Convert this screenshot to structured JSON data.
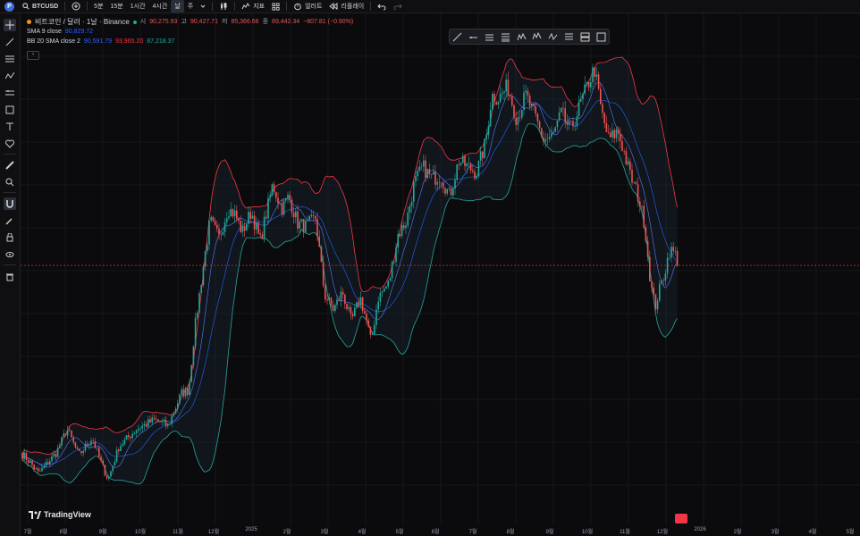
{
  "topbar": {
    "symbol": "BTCUSD",
    "avatar_letter": "P",
    "timeframes": [
      "5분",
      "15분",
      "1시간",
      "4시간",
      "날",
      "주"
    ],
    "active_timeframe_index": 4,
    "indicators": "지표",
    "alert": "얼러트",
    "replay": "리플레이"
  },
  "legend": {
    "title": "비트코인 / 달러 · 1날 · Binance",
    "open_label": "시",
    "open_value": "90,275.93",
    "high_label": "고",
    "high_value": "90,427.71",
    "low_label": "저",
    "low_value": "85,366.66",
    "close_label": "종",
    "close_value": "89,442.34",
    "change_value": "−807.81 (−0.90%)",
    "sma_label": "SMA 9 close",
    "sma_value": "90,829.72",
    "bb_label": "BB 20 SMA close 2",
    "bb_basis": "90,591.79",
    "bb_upper": "93,965.20",
    "bb_lower": "87,218.37"
  },
  "x_axis": {
    "ticks": [
      "7월",
      "8월",
      "9월",
      "10월",
      "11월",
      "12월",
      "2025",
      "2월",
      "3월",
      "4월",
      "5월",
      "6월",
      "7월",
      "8월",
      "9월",
      "10월",
      "11월",
      "12월",
      "2026",
      "2월",
      "3월",
      "4월",
      "5월"
    ]
  },
  "brand": {
    "logo_text": "TradingView"
  },
  "colors": {
    "up": "#26a69a",
    "down": "#ef5350",
    "sma": "#2962ff",
    "bb_upper": "#f23645",
    "bb_lower": "#26a69a",
    "bb_basis": "#2962ff",
    "price_line": "#f23645"
  },
  "chart_data": {
    "type": "candlestick",
    "interval": "1D",
    "x": [
      "2024-07",
      "2024-08",
      "2024-09",
      "2024-10",
      "2024-11",
      "2024-12",
      "2025-01",
      "2025-02",
      "2025-03",
      "2025-04",
      "2025-05",
      "2025-06",
      "2025-07",
      "2025-08",
      "2025-09",
      "2025-10",
      "2025-11",
      "2025-12"
    ],
    "close_approx": [
      64000,
      58000,
      63000,
      69000,
      96000,
      94000,
      102000,
      84000,
      82000,
      94000,
      104000,
      107000,
      116000,
      108000,
      114000,
      110000,
      91000,
      89442
    ],
    "last_close": 89442.34
  }
}
